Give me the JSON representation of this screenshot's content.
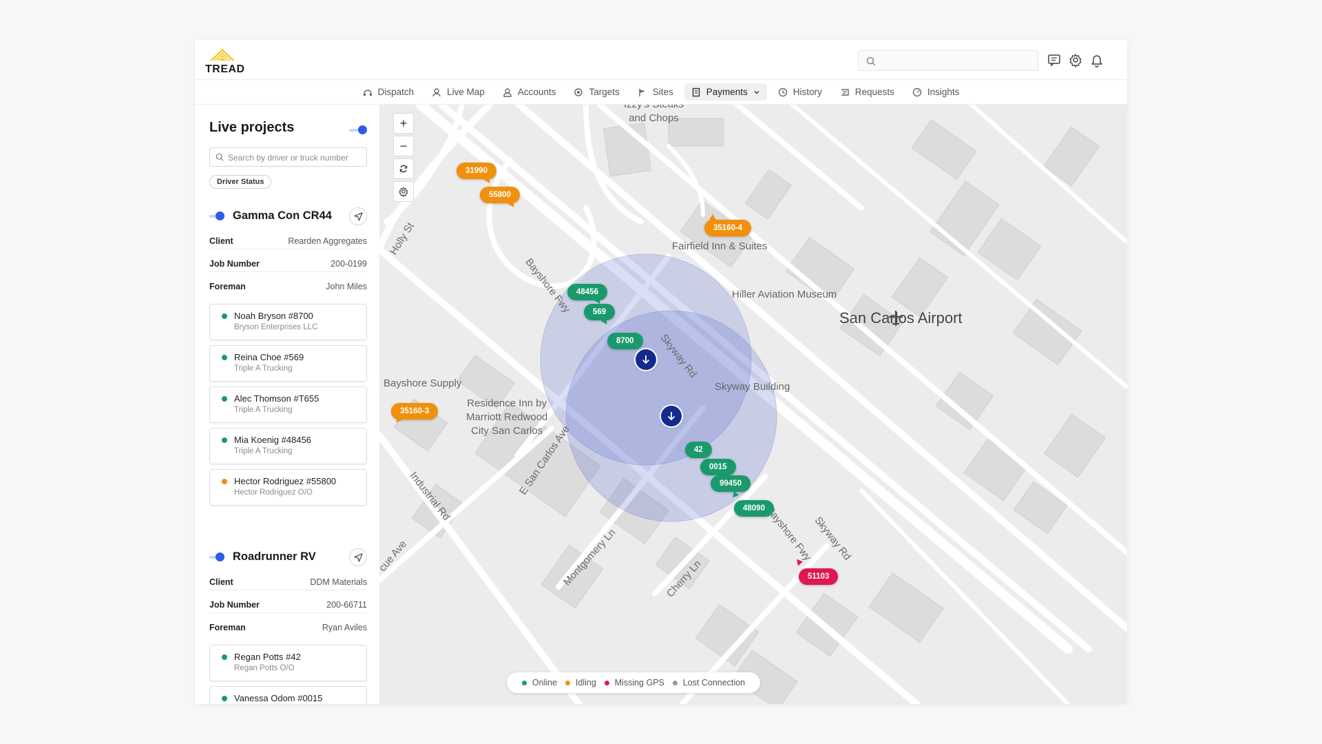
{
  "app": {
    "logo_text": "TREAD"
  },
  "header": {
    "search_placeholder": ""
  },
  "nav": {
    "items": [
      {
        "label": "Dispatch"
      },
      {
        "label": "Live Map"
      },
      {
        "label": "Accounts"
      },
      {
        "label": "Targets"
      },
      {
        "label": "Sites"
      },
      {
        "label": "Payments"
      },
      {
        "label": "History"
      },
      {
        "label": "Requests"
      },
      {
        "label": "Insights"
      }
    ],
    "active": "Payments"
  },
  "sidebar": {
    "title": "Live projects",
    "search_placeholder": "Search by driver or truck number",
    "filter_chip": "Driver Status",
    "projects": [
      {
        "name": "Gamma Con CR44",
        "fields": [
          {
            "key": "Client",
            "value": "Rearden Aggregates"
          },
          {
            "key": "Job Number",
            "value": "200-0199"
          },
          {
            "key": "Foreman",
            "value": "John Miles"
          }
        ],
        "drivers": [
          {
            "name": "Noah Bryson #8700",
            "company": "Bryson Enterprises LLC",
            "status": "online"
          },
          {
            "name": "Reina Choe #569",
            "company": "Triple A Trucking",
            "status": "online"
          },
          {
            "name": "Alec Thomson #T655",
            "company": "Triple A Trucking",
            "status": "online"
          },
          {
            "name": "Mia Koenig #48456",
            "company": "Triple A Trucking",
            "status": "online"
          },
          {
            "name": "Hector Rodriguez #55800",
            "company": "Hector Rodriguez O/O",
            "status": "idling"
          }
        ]
      },
      {
        "name": "Roadrunner RV",
        "fields": [
          {
            "key": "Client",
            "value": "DDM Materials"
          },
          {
            "key": "Job Number",
            "value": "200-66711"
          },
          {
            "key": "Foreman",
            "value": "Ryan Aviles"
          }
        ],
        "drivers": [
          {
            "name": "Regan Potts #42",
            "company": "Regan Potts O/O",
            "status": "online"
          },
          {
            "name": "Vanessa Odom #0015",
            "company": "",
            "status": "online"
          }
        ]
      }
    ]
  },
  "map": {
    "places": {
      "izzys": "Izzy's Steaks\nand Chops",
      "fairfield": "Fairfield Inn & Suites",
      "hiller": "Hiller Aviation Museum",
      "airport": "San Carlos Airport",
      "bayshore_supply": "Bayshore Supply",
      "residence_inn": "Residence Inn by\nMarriott Redwood\nCity San Carlos",
      "skyway_building": "Skyway Building"
    },
    "roads": {
      "holly": "Holly St",
      "bayshore1": "Bayshore Fwy",
      "bayshore2": "Bayshore Fwy",
      "bayshore3": "Bayshore Fwy",
      "bayshore4": "Bayshore Fwy",
      "skyway1": "Skyway Rd",
      "skyway2": "Skyway Rd",
      "esancarlos": "E San Carlos Ave",
      "industrial": "Industrial Rd",
      "montgomery": "Montgomery Ln",
      "cherry": "Cherry Ln",
      "cue": "cue Ave"
    },
    "markers": [
      {
        "label": "31990",
        "status": "idling"
      },
      {
        "label": "55800",
        "status": "idling"
      },
      {
        "label": "35160-4",
        "status": "idling"
      },
      {
        "label": "48456",
        "status": "online"
      },
      {
        "label": "569",
        "status": "online"
      },
      {
        "label": "8700",
        "status": "online"
      },
      {
        "label": "35160-3",
        "status": "idling"
      },
      {
        "label": "42",
        "status": "online"
      },
      {
        "label": "0015",
        "status": "online"
      },
      {
        "label": "99450",
        "status": "online"
      },
      {
        "label": "48090",
        "status": "online"
      },
      {
        "label": "51103",
        "status": "missing-gps"
      }
    ]
  },
  "legend": [
    {
      "label": "Online",
      "color": "#1a9a6c"
    },
    {
      "label": "Idling",
      "color": "#f0900c"
    },
    {
      "label": "Missing GPS",
      "color": "#e0184f"
    },
    {
      "label": "Lost Connection",
      "color": "#9a9a9a"
    }
  ],
  "colors": {
    "online": "#1a9a6c",
    "idling": "#f0900c",
    "missing_gps": "#e0184f",
    "accent": "#2f5bea",
    "pin": "#142a8c"
  }
}
